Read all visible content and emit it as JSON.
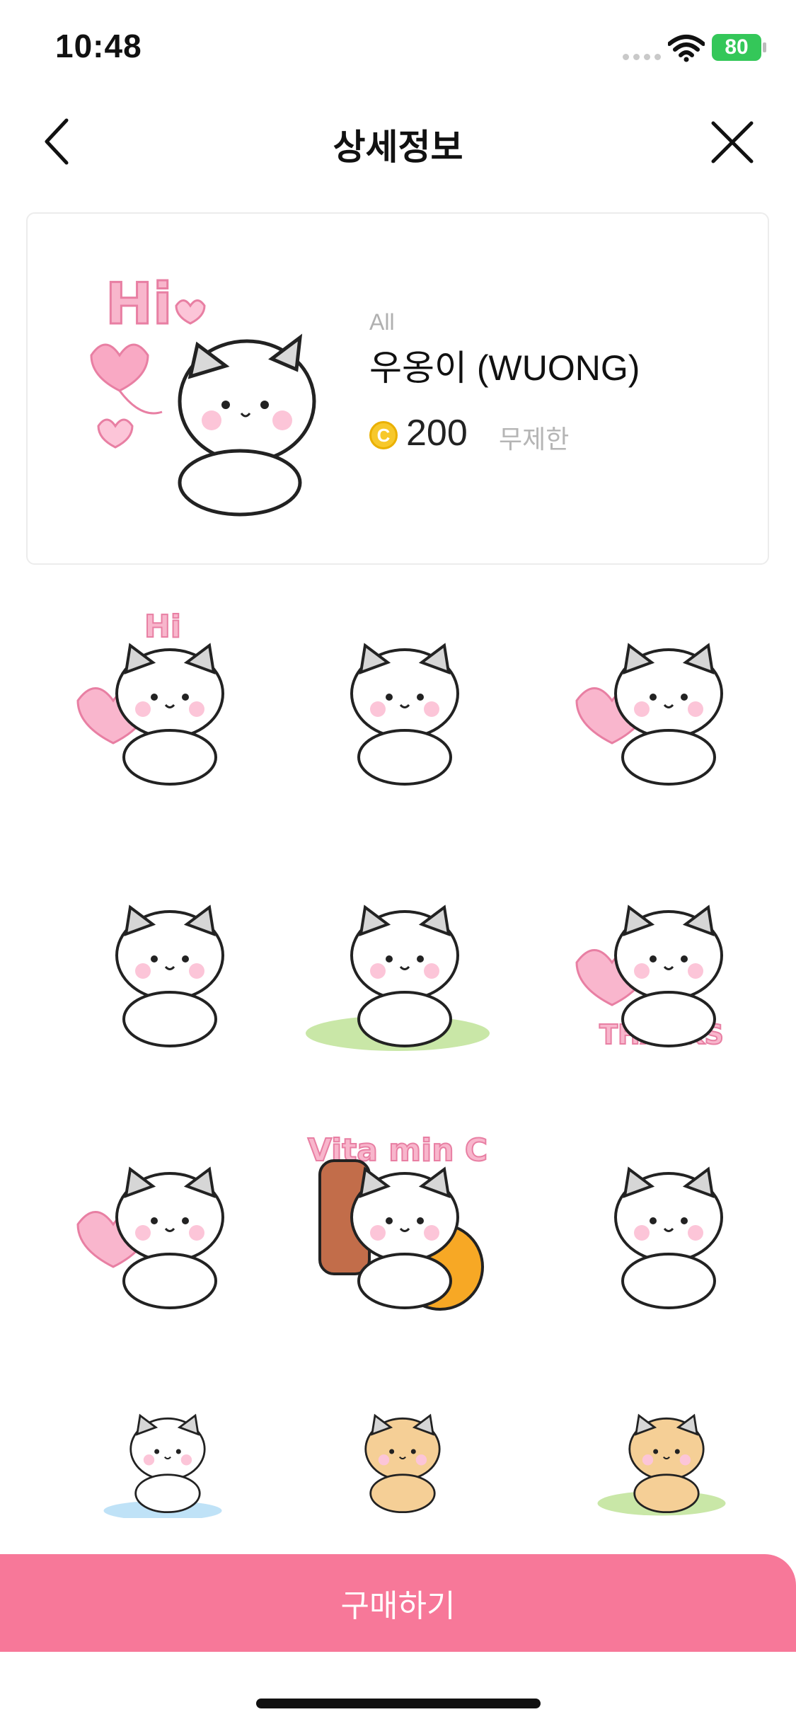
{
  "status_bar": {
    "time": "10:48",
    "battery": "80"
  },
  "nav": {
    "title": "상세정보"
  },
  "product": {
    "category": "All",
    "name": "우옹이 (WUONG)",
    "coin_symbol": "C",
    "price": "200",
    "period": "무제한"
  },
  "stickers": [
    {
      "id": "hi-balloon",
      "caption": "Hi"
    },
    {
      "id": "drum"
    },
    {
      "id": "headband-hearts"
    },
    {
      "id": "birthday-cake"
    },
    {
      "id": "four-leaf-clover"
    },
    {
      "id": "thanks-heart",
      "caption": "THANKS"
    },
    {
      "id": "big-heart-hug"
    },
    {
      "id": "vitamin-bottle",
      "caption": "Vita min C"
    },
    {
      "id": "3d-glasses-popcorn"
    },
    {
      "id": "crying-puddle"
    },
    {
      "id": "toilet-paper"
    },
    {
      "id": "flower-field"
    }
  ],
  "buy_button": {
    "label": "구매하기"
  },
  "colors": {
    "accent": "#f77899",
    "coin": "#f7c82b",
    "heart": "#f8a9c3"
  }
}
